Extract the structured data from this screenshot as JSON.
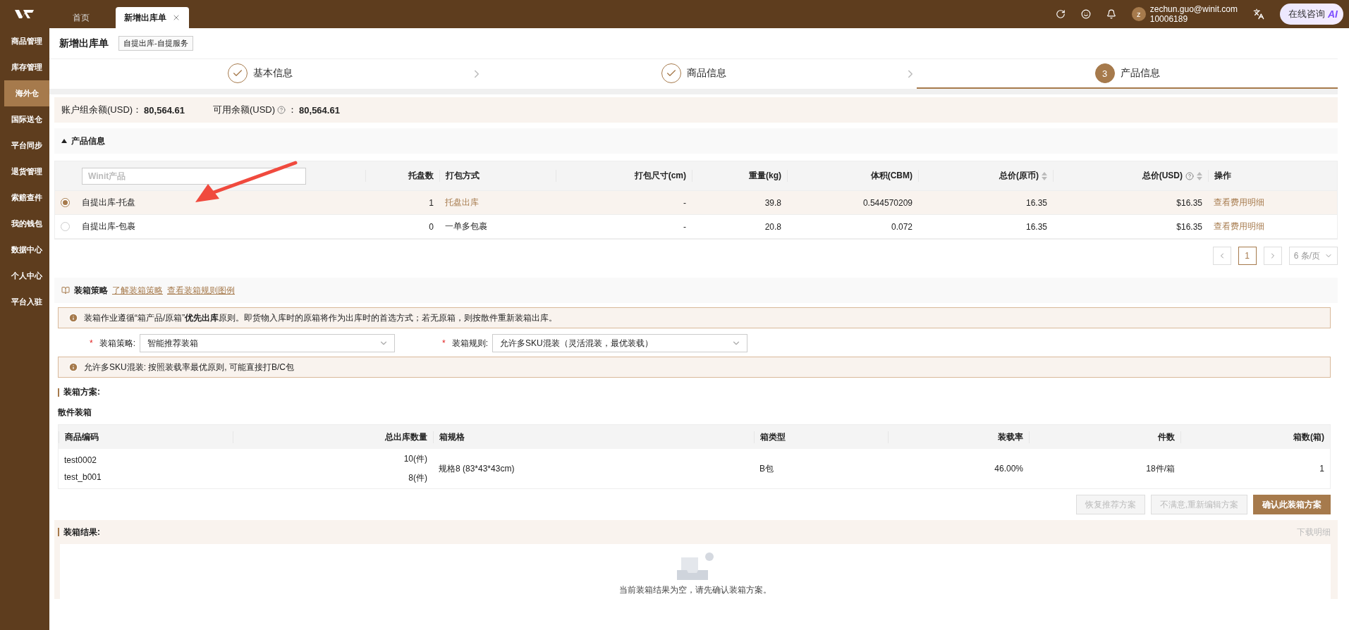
{
  "top_bar": {
    "tabs": [
      {
        "label": "首页",
        "selected": false,
        "closable": false
      },
      {
        "label": "新增出库单",
        "selected": true,
        "closable": true
      }
    ],
    "user": {
      "avatar_letter": "z",
      "email": "zechun.guo@winit.com",
      "account_id": "10006189"
    },
    "consult_button": "在线咨询",
    "ai_badge": "AI"
  },
  "sidebar": {
    "items": [
      {
        "label": "商品管理",
        "selected": false
      },
      {
        "label": "库存管理",
        "selected": false
      },
      {
        "label": "海外仓",
        "selected": true
      },
      {
        "label": "国际送仓",
        "selected": false
      },
      {
        "label": "平台同步",
        "selected": false
      },
      {
        "label": "退货管理",
        "selected": false
      },
      {
        "label": "索赔查件",
        "selected": false
      },
      {
        "label": "我的钱包",
        "selected": false
      },
      {
        "label": "数据中心",
        "selected": false
      },
      {
        "label": "个人中心",
        "selected": false
      },
      {
        "label": "平台入驻",
        "selected": false
      }
    ]
  },
  "page_header": {
    "title": "新增出库单",
    "tag": "自提出库-自提服务"
  },
  "steps": [
    {
      "label": "基本信息",
      "completed": true,
      "selected": false
    },
    {
      "label": "商品信息",
      "completed": true,
      "selected": false
    },
    {
      "number": "3",
      "label": "产品信息",
      "completed": false,
      "selected": true
    }
  ],
  "balance": {
    "account_label": "账户组余额(USD)：",
    "account_value": "80,564.61",
    "available_label": "可用余额(USD)",
    "available_colon": "：",
    "available_value": "80,564.61"
  },
  "product_section": {
    "title": "产品信息",
    "expanded": true,
    "search_placeholder": "Winit产品",
    "columns": [
      {
        "label": "托盘数",
        "sortable": false,
        "help": false
      },
      {
        "label": "打包方式",
        "sortable": false,
        "help": false
      },
      {
        "label": "打包尺寸(cm)",
        "sortable": false,
        "help": false
      },
      {
        "label": "重量(kg)",
        "sortable": false,
        "help": false
      },
      {
        "label": "体积(CBM)",
        "sortable": false,
        "help": false
      },
      {
        "label": "总价(原币)",
        "sortable": true,
        "help": false
      },
      {
        "label": "总价(USD)",
        "sortable": true,
        "help": true
      },
      {
        "label": "操作",
        "sortable": false,
        "help": false
      }
    ],
    "rows": [
      {
        "selected": true,
        "name": "自提出库-托盘",
        "packing_highlighted": true,
        "cells": [
          "1",
          "托盘出库",
          "-",
          "39.8",
          "0.544570209",
          "16.35",
          "$16.35",
          "查看费用明细"
        ]
      },
      {
        "selected": false,
        "name": "自提出库-包裹",
        "packing_highlighted": false,
        "cells": [
          "0",
          "一单多包裹",
          "-",
          "20.8",
          "0.072",
          "16.35",
          "$16.35",
          "查看费用明细"
        ]
      }
    ],
    "pagination": {
      "page": "1",
      "page_size": "6 条/页"
    }
  },
  "packing_strategy": {
    "title": "装箱策略",
    "links": [
      "了解装箱策略",
      "查看装箱规则图例"
    ],
    "notice": "装箱作业遵循“箱产品/原箱”**优先出库**原则。即货物入库时的原箱将作为出库时的首选方式；若无原箱，则按散件重新装箱出库。",
    "fields": [
      {
        "required_mark": "*",
        "label": "装箱策略:",
        "value": "智能推荐装箱"
      },
      {
        "required_mark": "*",
        "label": "装箱规则:",
        "value": "允许多SKU混装（灵活混装，最优装载）"
      }
    ],
    "rule_notice": "允许多SKU混装: 按照装载率最优原则, 可能直接打B/C包"
  },
  "packing_plan": {
    "title": "装箱方案:",
    "subtitle": "散件装箱",
    "columns": [
      "商品编码",
      "总出库数量",
      "箱规格",
      "箱类型",
      "装载率",
      "件数",
      "箱数(箱)"
    ],
    "rows": [
      {
        "items": [
          {
            "code": "test0002",
            "quantity": "10(件)"
          },
          {
            "code": "test_b001",
            "quantity": "8(件)"
          }
        ],
        "spec": "规格8 (83*43*43cm)",
        "type": "B包",
        "rate": "46.00%",
        "count": "18件/箱",
        "boxes": "1"
      }
    ],
    "buttons": [
      {
        "label": "恢复推荐方案",
        "kind": "default",
        "disabled": true
      },
      {
        "label": "不满意,重新编辑方案",
        "kind": "default",
        "disabled": true
      },
      {
        "label": "确认此装箱方案",
        "kind": "primary",
        "disabled": false
      }
    ]
  },
  "packing_result": {
    "title": "装箱结果:",
    "download_link": "下载明细",
    "download_disabled": true,
    "empty_text": "当前装箱结果为空，请先确认装箱方案。"
  }
}
